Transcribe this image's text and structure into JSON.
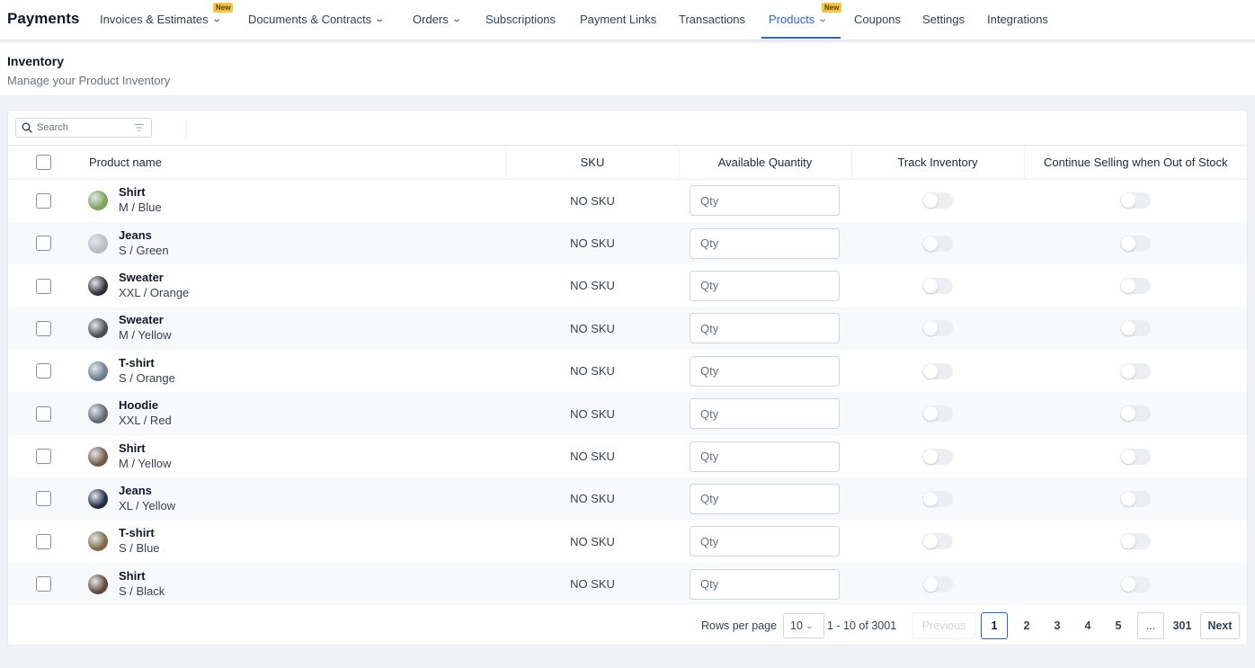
{
  "nav": {
    "brand": "Payments",
    "items": [
      {
        "label": "Invoices & Estimates",
        "dropdown": true,
        "badge": "New"
      },
      {
        "label": "Documents & Contracts",
        "dropdown": true
      },
      {
        "label": "Orders",
        "dropdown": true
      },
      {
        "label": "Subscriptions"
      },
      {
        "label": "Payment Links"
      },
      {
        "label": "Transactions"
      },
      {
        "label": "Products",
        "dropdown": true,
        "badge": "New",
        "active": true
      },
      {
        "label": "Coupons"
      },
      {
        "label": "Settings"
      },
      {
        "label": "Integrations"
      }
    ]
  },
  "page": {
    "title": "Inventory",
    "subtitle": "Manage your Product Inventory"
  },
  "search": {
    "placeholder": "Search"
  },
  "table": {
    "columns": [
      "Product name",
      "SKU",
      "Available Quantity",
      "Track Inventory",
      "Continue Selling when Out of Stock"
    ],
    "qty_placeholder": "Qty",
    "rows": [
      {
        "name": "Shirt",
        "variant": "M / Blue",
        "sku": "NO SKU",
        "thumb": "#7aa35c"
      },
      {
        "name": "Jeans",
        "variant": "S / Green",
        "sku": "NO SKU",
        "thumb": "#b9bcc2"
      },
      {
        "name": "Sweater",
        "variant": "XXL / Orange",
        "sku": "NO SKU",
        "thumb": "#2e3135"
      },
      {
        "name": "Sweater",
        "variant": "M / Yellow",
        "sku": "NO SKU",
        "thumb": "#4a4d52"
      },
      {
        "name": "T-shirt",
        "variant": "S / Orange",
        "sku": "NO SKU",
        "thumb": "#6b7a8c"
      },
      {
        "name": "Hoodie",
        "variant": "XXL / Red",
        "sku": "NO SKU",
        "thumb": "#5d6670"
      },
      {
        "name": "Shirt",
        "variant": "M / Yellow",
        "sku": "NO SKU",
        "thumb": "#6e5a48"
      },
      {
        "name": "Jeans",
        "variant": "XL / Yellow",
        "sku": "NO SKU",
        "thumb": "#1f2a44"
      },
      {
        "name": "T-shirt",
        "variant": "S / Blue",
        "sku": "NO SKU",
        "thumb": "#7d6a45"
      },
      {
        "name": "Shirt",
        "variant": "S / Black",
        "sku": "NO SKU",
        "thumb": "#5e4a3a"
      }
    ]
  },
  "pagination": {
    "rows_label": "Rows per page",
    "rows_value": "10",
    "range": "1 - 10 of 3001",
    "previous": "Previous",
    "pages": [
      "1",
      "2",
      "3",
      "4",
      "5"
    ],
    "ellipsis": "...",
    "last": "301",
    "next": "Next"
  },
  "colors": {
    "accent": "#2563eb",
    "badge": "#f5c542"
  }
}
